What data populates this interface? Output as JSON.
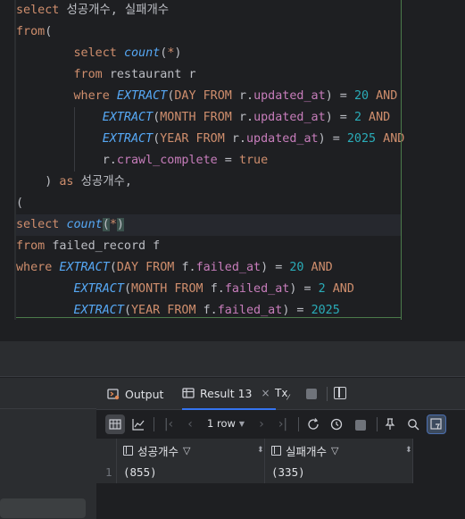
{
  "editor": {
    "lines": [
      {
        "segments": [
          {
            "t": "select ",
            "c": "kw"
          },
          {
            "t": "성공개수, 실패개수",
            "c": "plain"
          }
        ]
      },
      {
        "segments": [
          {
            "t": "from",
            "c": "kw"
          },
          {
            "t": "(",
            "c": "plain"
          }
        ]
      },
      {
        "segments": [
          {
            "t": "        ",
            "c": "plain"
          },
          {
            "t": "select ",
            "c": "kw"
          },
          {
            "t": "count",
            "c": "fn"
          },
          {
            "t": "(",
            "c": "plain"
          },
          {
            "t": "*",
            "c": "kw"
          },
          {
            "t": ")",
            "c": "plain"
          }
        ]
      },
      {
        "segments": [
          {
            "t": "        ",
            "c": "plain"
          },
          {
            "t": "from ",
            "c": "kw"
          },
          {
            "t": "restaurant r",
            "c": "plain"
          }
        ]
      },
      {
        "segments": [
          {
            "t": "        ",
            "c": "plain"
          },
          {
            "t": "where ",
            "c": "kw"
          },
          {
            "t": "EXTRACT",
            "c": "fn"
          },
          {
            "t": "(",
            "c": "plain"
          },
          {
            "t": "DAY FROM ",
            "c": "kw"
          },
          {
            "t": "r.",
            "c": "plain"
          },
          {
            "t": "updated_at",
            "c": "col"
          },
          {
            "t": ") = ",
            "c": "plain"
          },
          {
            "t": "20",
            "c": "num"
          },
          {
            "t": " AND",
            "c": "kw"
          }
        ]
      },
      {
        "segments": [
          {
            "t": "            ",
            "c": "plain"
          },
          {
            "t": "EXTRACT",
            "c": "fn"
          },
          {
            "t": "(",
            "c": "plain"
          },
          {
            "t": "MONTH FROM ",
            "c": "kw"
          },
          {
            "t": "r.",
            "c": "plain"
          },
          {
            "t": "updated_at",
            "c": "col"
          },
          {
            "t": ") = ",
            "c": "plain"
          },
          {
            "t": "2",
            "c": "num"
          },
          {
            "t": " AND",
            "c": "kw"
          }
        ]
      },
      {
        "segments": [
          {
            "t": "            ",
            "c": "plain"
          },
          {
            "t": "EXTRACT",
            "c": "fn"
          },
          {
            "t": "(",
            "c": "plain"
          },
          {
            "t": "YEAR FROM ",
            "c": "kw"
          },
          {
            "t": "r.",
            "c": "plain"
          },
          {
            "t": "updated_at",
            "c": "col"
          },
          {
            "t": ") = ",
            "c": "plain"
          },
          {
            "t": "2025",
            "c": "num"
          },
          {
            "t": " AND",
            "c": "kw"
          }
        ]
      },
      {
        "segments": [
          {
            "t": "            ",
            "c": "plain"
          },
          {
            "t": "r.",
            "c": "plain"
          },
          {
            "t": "crawl_complete",
            "c": "col"
          },
          {
            "t": " = ",
            "c": "plain"
          },
          {
            "t": "true",
            "c": "kw"
          }
        ]
      },
      {
        "segments": [
          {
            "t": "    ",
            "c": "plain"
          },
          {
            "t": ") ",
            "c": "plain"
          },
          {
            "t": "as ",
            "c": "kw"
          },
          {
            "t": "성공개수,",
            "c": "plain"
          }
        ]
      },
      {
        "segments": [
          {
            "t": "(",
            "c": "plain"
          }
        ]
      },
      {
        "highlight": true,
        "segments": [
          {
            "t": "select ",
            "c": "kw"
          },
          {
            "t": "count",
            "c": "fn"
          },
          {
            "t": "(",
            "c": "paren-hl"
          },
          {
            "t": "*",
            "c": "kw"
          },
          {
            "t": ")",
            "c": "paren-hl"
          }
        ]
      },
      {
        "segments": [
          {
            "t": "from ",
            "c": "kw"
          },
          {
            "t": "failed_record f",
            "c": "plain"
          }
        ]
      },
      {
        "segments": [
          {
            "t": "where ",
            "c": "kw"
          },
          {
            "t": "EXTRACT",
            "c": "fn"
          },
          {
            "t": "(",
            "c": "plain"
          },
          {
            "t": "DAY FROM ",
            "c": "kw"
          },
          {
            "t": "f.",
            "c": "plain"
          },
          {
            "t": "failed_at",
            "c": "col"
          },
          {
            "t": ") = ",
            "c": "plain"
          },
          {
            "t": "20",
            "c": "num"
          },
          {
            "t": " AND",
            "c": "kw"
          }
        ]
      },
      {
        "segments": [
          {
            "t": "        ",
            "c": "plain"
          },
          {
            "t": "EXTRACT",
            "c": "fn"
          },
          {
            "t": "(",
            "c": "plain"
          },
          {
            "t": "MONTH FROM ",
            "c": "kw"
          },
          {
            "t": "f.",
            "c": "plain"
          },
          {
            "t": "failed_at",
            "c": "col"
          },
          {
            "t": ") = ",
            "c": "plain"
          },
          {
            "t": "2",
            "c": "num"
          },
          {
            "t": " AND",
            "c": "kw"
          }
        ]
      },
      {
        "segments": [
          {
            "t": "        ",
            "c": "plain"
          },
          {
            "t": "EXTRACT",
            "c": "fn"
          },
          {
            "t": "(",
            "c": "plain"
          },
          {
            "t": "YEAR FROM ",
            "c": "kw"
          },
          {
            "t": "f.",
            "c": "plain"
          },
          {
            "t": "failed_at",
            "c": "col"
          },
          {
            "t": ") = ",
            "c": "plain"
          },
          {
            "t": "2025",
            "c": "num"
          }
        ]
      }
    ]
  },
  "tabs": {
    "output_label": "Output",
    "result_label": "Result 13",
    "close_glyph": "×",
    "tx_label": "Tx"
  },
  "toolbar": {
    "row_count": "1 row",
    "icons": [
      "table-view-icon",
      "chart-view-icon",
      "first-page-icon",
      "prev-page-icon",
      "next-page-icon",
      "last-page-icon",
      "refresh-icon",
      "history-icon",
      "stop-icon",
      "pin-icon",
      "search-icon",
      "filter-icon"
    ]
  },
  "grid": {
    "columns": [
      "성공개수",
      "실패개수"
    ],
    "rows": [
      {
        "num": "1",
        "values": [
          "(855)",
          "(335)"
        ]
      }
    ]
  },
  "colors": {
    "keyword": "#cf8e6d",
    "function": "#56a8f5",
    "column": "#c77dbb",
    "number": "#2aacb8",
    "accent": "#3574f0"
  }
}
